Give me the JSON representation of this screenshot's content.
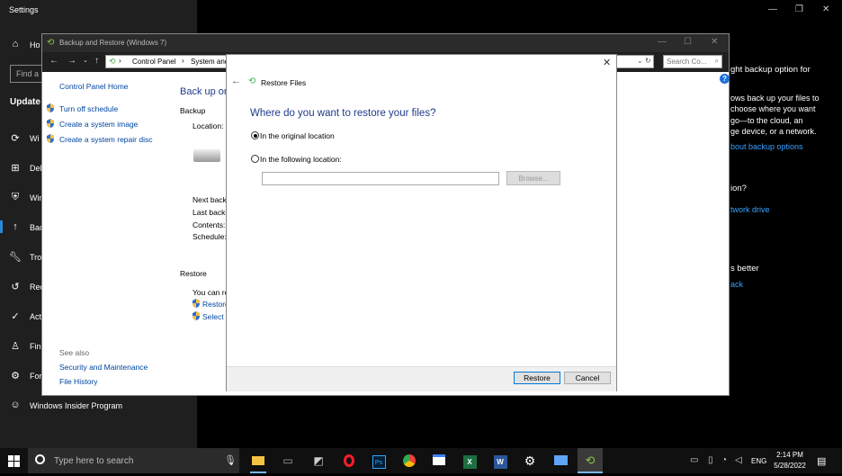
{
  "settings": {
    "title": "Settings",
    "home_label": "Ho",
    "find_placeholder": "Find a",
    "section_title": "Update",
    "sidebar_items": [
      {
        "label": "Wi",
        "icon": "sync-icon"
      },
      {
        "label": "Del",
        "icon": "delivery-icon"
      },
      {
        "label": "Win",
        "icon": "shield-icon"
      },
      {
        "label": "Bac",
        "icon": "backup-icon"
      },
      {
        "label": "Tro",
        "icon": "wrench-icon"
      },
      {
        "label": "Rec",
        "icon": "recovery-icon"
      },
      {
        "label": "Act",
        "icon": "check-circle-icon"
      },
      {
        "label": "Fin",
        "icon": "person-icon"
      },
      {
        "label": "For",
        "icon": "developer-icon"
      },
      {
        "label": "Windows Insider Program",
        "icon": "insider-icon"
      }
    ],
    "right_panel": {
      "line1": "ght backup option for",
      "para": [
        "ows back up your files to",
        "choose where you want",
        "go—to the cloud, an",
        "ge device, or a network."
      ],
      "link1": "bout backup options",
      "question": "ion?",
      "link2": "twork drive",
      "better": "s better",
      "link3": "ack"
    }
  },
  "control_panel": {
    "title": "Backup and Restore (Windows 7)",
    "breadcrumb": [
      "Control Panel",
      "System and"
    ],
    "search_placeholder": "Search Co...",
    "sidebar": {
      "home": "Control Panel Home",
      "links": [
        "Turn off schedule",
        "Create a system image",
        "Create a system repair disc"
      ],
      "see_also_label": "See also",
      "see_also_links": [
        "Security and Maintenance",
        "File History"
      ]
    },
    "main": {
      "heading": "Back up or",
      "backup_label": "Backup",
      "location_label": "Location:",
      "next_backup": "Next back",
      "last_backup": "Last backu",
      "contents": "Contents:",
      "schedule": "Schedule:",
      "restore_label": "Restore",
      "you_can": "You can re",
      "restore_link": "Restore",
      "select_link": "Select a"
    }
  },
  "dialog": {
    "title": "Restore Files",
    "heading": "Where do you want to restore your files?",
    "option_original": "In the original location",
    "option_following": "In the following location:",
    "path_value": "",
    "browse_label": "Browse...",
    "restore_label": "Restore",
    "cancel_label": "Cancel"
  },
  "taskbar": {
    "search_placeholder": "Type here to search",
    "apps": [
      {
        "name": "file-explorer",
        "icon": "folder-icon",
        "color": "#f5c242"
      },
      {
        "name": "app2",
        "icon": "laptop-icon",
        "color": "#9aa7b5"
      },
      {
        "name": "app3",
        "icon": "photos-icon",
        "color": "#ccc"
      },
      {
        "name": "opera",
        "icon": "opera-icon",
        "color": "#ff1b2d"
      },
      {
        "name": "photoshop",
        "icon": "photoshop-icon",
        "color": "#31a8ff"
      },
      {
        "name": "chrome",
        "icon": "chrome-icon",
        "color": "#4caf50"
      },
      {
        "name": "app7",
        "icon": "window-icon",
        "color": "#3b82f6"
      },
      {
        "name": "excel",
        "icon": "excel-icon",
        "color": "#1d6f42"
      },
      {
        "name": "word",
        "icon": "word-icon",
        "color": "#2b579a"
      },
      {
        "name": "settings",
        "icon": "gear-icon",
        "color": "#ffffff"
      },
      {
        "name": "app11",
        "icon": "display-icon",
        "color": "#60a5fa"
      },
      {
        "name": "backup",
        "icon": "backup-icon",
        "color": "#8bc34a"
      }
    ],
    "lang": "ENG",
    "time": "2:14 PM",
    "date": "5/28/2022"
  }
}
